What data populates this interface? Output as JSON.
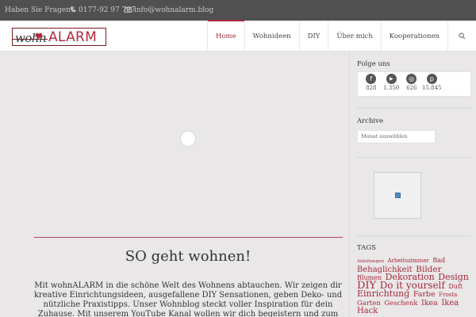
{
  "topbar": {
    "question": "Haben Sie Fragen?",
    "phone": "0177-92 97 787",
    "email": "info@wohnalarm.blog"
  },
  "logo": {
    "part1": "wohn",
    "part2": "ALARM"
  },
  "nav": {
    "items": [
      {
        "label": "Home",
        "active": true
      },
      {
        "label": "Wohnideen"
      },
      {
        "label": "DIY"
      },
      {
        "label": "Über mich"
      },
      {
        "label": "Kooperationen"
      }
    ]
  },
  "main": {
    "headline": "SO geht wohnen!",
    "intro": "Mit wohnALARM in die schöne Welt des Wohnens abtauchen. Wir zeigen dir kreative Einrichtungsideen, ausgefallene DIY Sensationen, geben Deko- und nützliche Praxistipps. Unser Wohnblog steckt voller Inspiration für dein Zuhause. Mit unserem YouTube Kanal wollen wir dich begeistern und zum Nachmachen und"
  },
  "sidebar": {
    "follow_title": "Folge uns",
    "social": [
      {
        "icon": "facebook-icon",
        "glyph": "f",
        "count": "828"
      },
      {
        "icon": "youtube-icon",
        "glyph": "▶",
        "count": "1.350"
      },
      {
        "icon": "instagram-icon",
        "glyph": "◎",
        "count": "626"
      },
      {
        "icon": "pinterest-icon",
        "glyph": "p",
        "count": "15.845"
      }
    ],
    "archive_title": "Archive",
    "archive_select": "Monat auswählen",
    "tags_title": "TAGS",
    "tags": [
      {
        "label": "Anleitungen",
        "size": 5.5
      },
      {
        "label": "Arbeitszimmer",
        "size": 7
      },
      {
        "label": "Bad",
        "size": 8
      },
      {
        "label": "Behaglichkeit",
        "size": 10
      },
      {
        "label": "Bilder",
        "size": 10.5
      },
      {
        "label": "Blumen",
        "size": 8
      },
      {
        "label": "Dekoration",
        "size": 11
      },
      {
        "label": "Design",
        "size": 11
      },
      {
        "label": "DIY",
        "size": 13
      },
      {
        "label": "Do it yourself",
        "size": 12
      },
      {
        "label": "Duft",
        "size": 8
      },
      {
        "label": "Einrichtung",
        "size": 11
      },
      {
        "label": "Farbe",
        "size": 9.5
      },
      {
        "label": "Frosta",
        "size": 7
      },
      {
        "label": "Garten",
        "size": 8.5
      },
      {
        "label": "Geschenk",
        "size": 8.5
      },
      {
        "label": "Ikea",
        "size": 9.5
      },
      {
        "label": "Ikea Hack",
        "size": 10
      }
    ]
  },
  "colors": {
    "accent": "#a52a3a",
    "topbar_bg": "#505050",
    "page_bg": "#e9e7e8"
  }
}
